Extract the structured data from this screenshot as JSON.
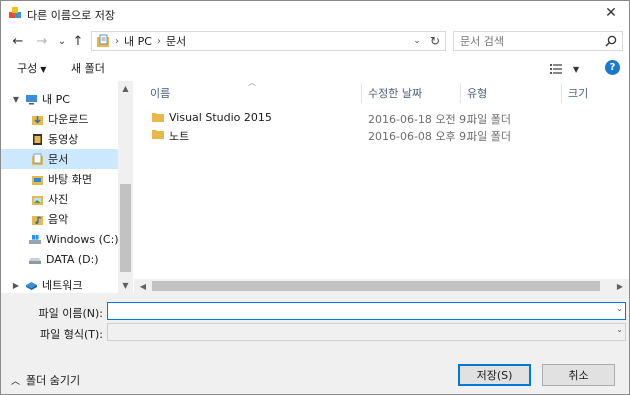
{
  "window": {
    "title": "다른 이름으로 저장",
    "close_glyph": "✕"
  },
  "nav": {
    "back_glyph": "←",
    "forward_glyph": "→",
    "recent_glyph": "⌄",
    "up_glyph": "↑",
    "address_segments": [
      "내 PC",
      "문서"
    ],
    "refresh_glyph": "↻"
  },
  "search": {
    "placeholder": "문서 검색"
  },
  "toolbar": {
    "organize_label": "구성",
    "new_folder_label": "새 폴더",
    "help_label": "?"
  },
  "sidebar": {
    "items": [
      {
        "label": "내 PC",
        "icon": "computer-icon",
        "expanded": true
      },
      {
        "label": "다운로드",
        "icon": "downloads-folder-icon"
      },
      {
        "label": "동영상",
        "icon": "videos-folder-icon"
      },
      {
        "label": "문서",
        "icon": "documents-folder-icon",
        "selected": true
      },
      {
        "label": "바탕 화면",
        "icon": "desktop-folder-icon"
      },
      {
        "label": "사진",
        "icon": "pictures-folder-icon"
      },
      {
        "label": "음악",
        "icon": "music-folder-icon"
      },
      {
        "label": "Windows (C:)",
        "icon": "system-drive-icon"
      },
      {
        "label": "DATA (D:)",
        "icon": "drive-icon"
      },
      {
        "label": "네트워크",
        "icon": "network-icon"
      }
    ]
  },
  "filelist": {
    "columns": [
      "이름",
      "수정한 날짜",
      "유형",
      "크기"
    ],
    "rows": [
      {
        "name": "Visual Studio 2015",
        "modified": "2016-06-18 오전 9...",
        "type": "파일 폴더",
        "size": ""
      },
      {
        "name": "노트",
        "modified": "2016-06-08 오후 9...",
        "type": "파일 폴더",
        "size": ""
      }
    ]
  },
  "form": {
    "filename_label": "파일 이름(N):",
    "filename_value": "",
    "filetype_label": "파일 형식(T):",
    "filetype_value": ""
  },
  "footer": {
    "hide_folders_label": "폴더 숨기기",
    "save_label": "저장(S)",
    "cancel_label": "취소"
  },
  "colors": {
    "selection": "#cce8ff",
    "accent": "#0078d7",
    "folder": "#e8b84a",
    "help": "#1979ca"
  }
}
